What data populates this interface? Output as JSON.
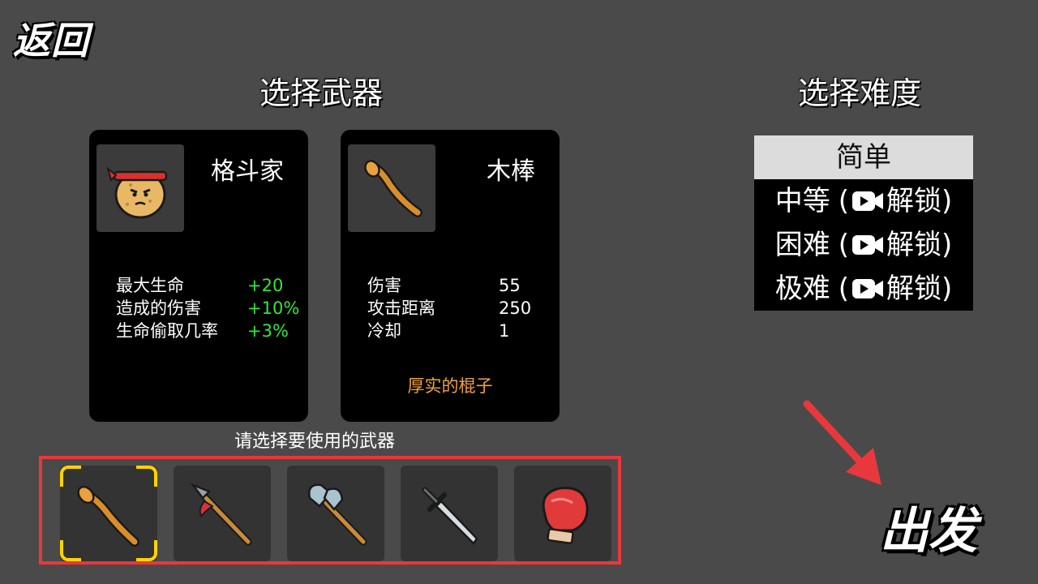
{
  "nav": {
    "back_label": "返回",
    "go_label": "出发"
  },
  "weapon_section": {
    "title": "选择武器",
    "hint": "请选择要使用的武器"
  },
  "character_card": {
    "name": "格斗家",
    "stats": [
      {
        "label": "最大生命",
        "value": "+20"
      },
      {
        "label": "造成的伤害",
        "value": "+10%"
      },
      {
        "label": "生命偷取几率",
        "value": "+3%"
      }
    ]
  },
  "weapon_card": {
    "name": "木棒",
    "stats": [
      {
        "label": "伤害",
        "value": "55"
      },
      {
        "label": "攻击距离",
        "value": "250"
      },
      {
        "label": "冷却",
        "value": "1"
      }
    ],
    "description": "厚实的棍子"
  },
  "weapon_slots": [
    {
      "icon": "wooden-club-icon",
      "selected": true
    },
    {
      "icon": "spear-icon",
      "selected": false
    },
    {
      "icon": "battle-axe-icon",
      "selected": false
    },
    {
      "icon": "sword-icon",
      "selected": false
    },
    {
      "icon": "boxing-glove-icon",
      "selected": false
    }
  ],
  "difficulty_section": {
    "title": "选择难度",
    "options": [
      {
        "label": "简单",
        "locked": false,
        "selected": true
      },
      {
        "label": "中等",
        "prefix": "(",
        "lock_text": "解锁)",
        "locked": true,
        "selected": false
      },
      {
        "label": "困难",
        "prefix": "(",
        "lock_text": "解锁)",
        "locked": true,
        "selected": false
      },
      {
        "label": "极难",
        "prefix": "(",
        "lock_text": "解锁)",
        "locked": true,
        "selected": false
      }
    ]
  },
  "colors": {
    "background": "#4a4a4a",
    "positive_stat": "#2ee83a",
    "description": "#f2a23a",
    "selection_frame": "#e8383d",
    "selected_slot_corner": "#ffd400"
  }
}
